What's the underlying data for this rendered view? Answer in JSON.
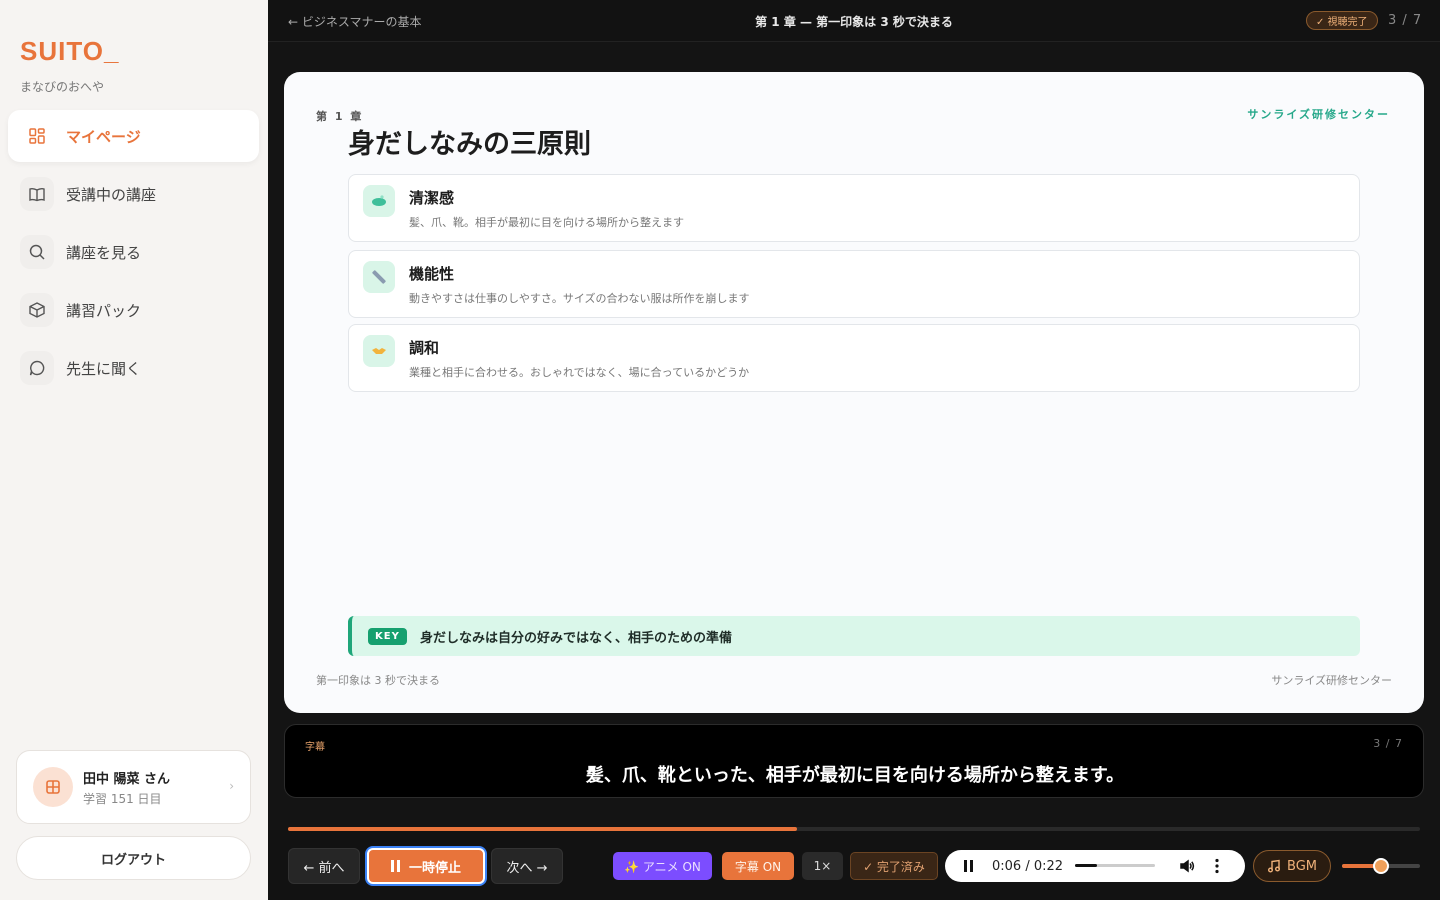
{
  "sidebar": {
    "logo": "SUITO_",
    "subtitle": "まなびのおへや",
    "items": [
      {
        "label": "マイページ",
        "active": true
      },
      {
        "label": "受講中の講座"
      },
      {
        "label": "講座を見る"
      },
      {
        "label": "講習パック"
      },
      {
        "label": "先生に聞く"
      }
    ],
    "user": {
      "name": "田中 陽菜 さん",
      "sub": "学習 151 日目"
    },
    "logout": "ログアウト"
  },
  "topbar": {
    "back": "← ビジネスマナーの基本",
    "title": "第 1 章 — 第一印象は 3 秒で決まる",
    "badge": "✓ 視聴完了",
    "count": "3 / 7"
  },
  "slide": {
    "chapter": "第 1 章",
    "title": "身だしなみの三原則",
    "brand": "サンライズ研修センター",
    "cards": [
      {
        "title": "清潔感",
        "desc": "髪、爪、靴。相手が最初に目を向ける場所から整えます",
        "icon": "soap-icon"
      },
      {
        "title": "機能性",
        "desc": "動きやすさは仕事のしやすさ。サイズの合わない服は所作を崩します",
        "icon": "ruler-icon"
      },
      {
        "title": "調和",
        "desc": "業種と相手に合わせる。おしゃれではなく、場に合っているかどうか",
        "icon": "handshake-icon"
      }
    ],
    "key_label": "KEY",
    "key_text": "身だしなみは自分の好みではなく、相手のための準備",
    "footer_left": "第一印象は 3 秒で決まる",
    "footer_right": "サンライズ研修センター"
  },
  "subtitles": {
    "label": "字幕",
    "count": "3 / 7",
    "text": "髪、爪、靴といった、相手が最初に目を向ける場所から整えます。"
  },
  "controls": {
    "progress": 0.45,
    "prev": "← 前へ",
    "pause": "一時停止",
    "next": "次へ →",
    "anim": "✨ アニメ ON",
    "sub": "字幕 ON",
    "speed": "1×",
    "done": "✓ 完了済み",
    "time": "0:06 / 0:22",
    "audio_progress": 0.27,
    "bgm": "BGM",
    "volume": 0.5
  },
  "colors": {
    "accent": "#e8743b",
    "green": "#1fa67a",
    "purple": "#7c4dff"
  }
}
